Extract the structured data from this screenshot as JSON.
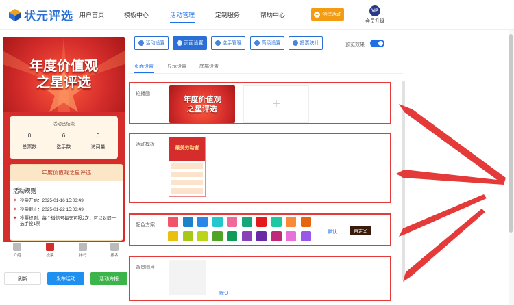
{
  "brand": {
    "name": "状元评选",
    "color": "#2a6fd6"
  },
  "nav": {
    "items": [
      "用户首页",
      "模板中心",
      "活动管理",
      "定制服务",
      "帮助中心"
    ],
    "active": "活动管理"
  },
  "header": {
    "create_label": "创建活动",
    "vip_badge": "VIP",
    "vip_label": "会员升级"
  },
  "preview": {
    "banner_line1": "年度价值观",
    "banner_line2": "之星评选",
    "status": "活动已结束",
    "stats": [
      {
        "value": "0",
        "label": "总票数"
      },
      {
        "value": "6",
        "label": "选手数"
      },
      {
        "value": "0",
        "label": "访问量"
      }
    ],
    "rules_header": "年度价值观之星评选",
    "rules_title": "活动规则",
    "rules": [
      "投票开始：2025-01-16 15:03:49",
      "投票截止：2025-01-22 15:03:49",
      "投票规则：每个微信号每天可投2次，可以对同一选手投1票"
    ],
    "bottom_nav": [
      "介绍",
      "投票",
      "排行",
      "报名"
    ]
  },
  "actions": {
    "refresh": "刷新",
    "publish": "发布活动",
    "poster": "活动海报"
  },
  "toolbar": {
    "buttons": [
      "活动设置",
      "页面设置",
      "选手管理",
      "高级设置",
      "投票统计"
    ],
    "active": "页面设置",
    "preview_label": "预览效果"
  },
  "subtabs": {
    "items": [
      "页面设置",
      "显示设置",
      "底部设置"
    ],
    "active": "页面设置"
  },
  "sections": {
    "carousel_label": "轮播图",
    "carousel_slide_line1": "年度价值观",
    "carousel_slide_line2": "之星评选",
    "add_symbol": "+",
    "template_label": "活动模板",
    "template_thumb_title": "最美劳动者",
    "color_label": "配色方案",
    "color_default": "默认",
    "color_custom": "自定义",
    "background_label": "背景图片",
    "background_default": "默认"
  },
  "swatches": {
    "row1": [
      "#f0556a",
      "#1e82c8",
      "#2a86e8",
      "#22c8cc",
      "#ef6a9a",
      "#14a878",
      "#e51b1b",
      "#1ec8a0",
      "#f88a3a",
      "#e6650e"
    ],
    "row2": [
      "#e8c010",
      "#a8c818",
      "#bcd418",
      "#52a428",
      "#129a58",
      "#8a40b8",
      "#6a2aa8",
      "#c0287a",
      "#e870d8",
      "#9a58e8"
    ]
  },
  "highlight_color": "#e53a3a"
}
